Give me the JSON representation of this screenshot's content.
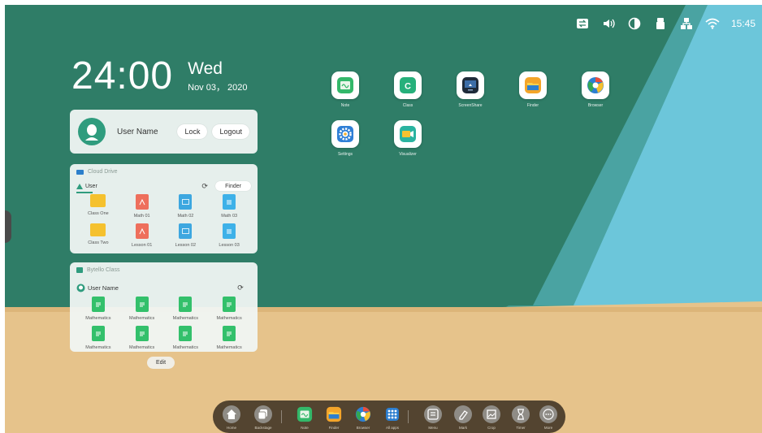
{
  "status_bar": {
    "icons": [
      "input-switch-icon",
      "volume-icon",
      "contrast-icon",
      "usb-icon",
      "network-icon",
      "wifi-icon"
    ],
    "time": "15:45"
  },
  "clock": {
    "time": "24:00",
    "day": "Wed",
    "date": "Nov 03， 2020"
  },
  "user_card": {
    "user_name": "User Name",
    "lock_label": "Lock",
    "logout_label": "Logout"
  },
  "cloud_drive": {
    "title": "Cloud Drive",
    "user_label": "User",
    "finder_label": "Finder",
    "files": [
      {
        "name": "Class One",
        "type": "folder"
      },
      {
        "name": "Math 01",
        "type": "pdf"
      },
      {
        "name": "Math 02",
        "type": "image"
      },
      {
        "name": "Math 03",
        "type": "doc"
      },
      {
        "name": "Class Two",
        "type": "folder"
      },
      {
        "name": "Lesson 01",
        "type": "pdf"
      },
      {
        "name": "Lesson 02",
        "type": "image"
      },
      {
        "name": "Lesson 03",
        "type": "doc"
      }
    ]
  },
  "class_card": {
    "title": "Bytello Class",
    "user_name": "User Name",
    "files": [
      "Mathematics",
      "Mathematics",
      "Mathematics",
      "Mathematics",
      "Mathematics",
      "Mathematics",
      "Mathematics",
      "Mathematics"
    ]
  },
  "edit_label": "Edit",
  "desktop_apps": [
    {
      "label": "Note",
      "icon": "note-icon"
    },
    {
      "label": "Class",
      "icon": "class-icon"
    },
    {
      "label": "ScreenShare",
      "icon": "screenshare-icon"
    },
    {
      "label": "Finder",
      "icon": "finder-icon"
    },
    {
      "label": "Browser",
      "icon": "browser-icon"
    },
    {
      "label": "Settings",
      "icon": "settings-icon"
    },
    {
      "label": "Visualizer",
      "icon": "visualizer-icon"
    }
  ],
  "dock": [
    {
      "label": "Home",
      "icon": "home-icon"
    },
    {
      "label": "Backstage",
      "icon": "backstage-icon"
    },
    {
      "label": "Note",
      "icon": "note-icon"
    },
    {
      "label": "Finder",
      "icon": "finder-icon"
    },
    {
      "label": "Browser",
      "icon": "browser-icon"
    },
    {
      "label": "All apps",
      "icon": "all-apps-icon"
    },
    {
      "label": "Menu",
      "icon": "menu-icon"
    },
    {
      "label": "Mark",
      "icon": "mark-icon"
    },
    {
      "label": "Crop",
      "icon": "crop-icon"
    },
    {
      "label": "Timer",
      "icon": "timer-icon"
    },
    {
      "label": "More",
      "icon": "more-icon"
    }
  ],
  "colors": {
    "green": "#2f7d67",
    "teal": "#4aa7a3",
    "sky": "#6ec8dc",
    "sand": "#e8c48a",
    "accent": "#2f9c7e"
  }
}
